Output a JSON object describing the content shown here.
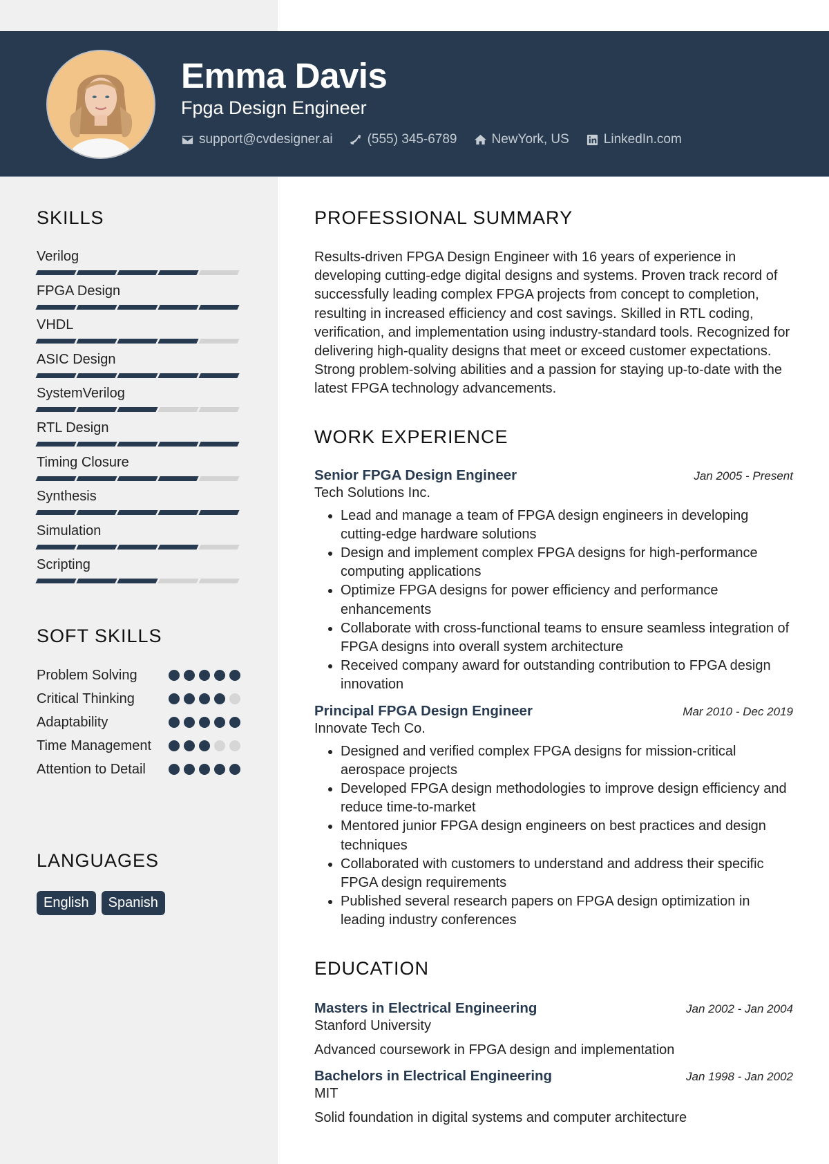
{
  "profile": {
    "name": "Emma Davis",
    "title": "Fpga Design Engineer",
    "contacts": [
      {
        "icon": "envelope-icon",
        "text": "support@cvdesigner.ai"
      },
      {
        "icon": "phone-icon",
        "text": "(555) 345-6789"
      },
      {
        "icon": "home-icon",
        "text": "NewYork, US"
      },
      {
        "icon": "linkedin-icon",
        "text": "LinkedIn.com"
      }
    ]
  },
  "colors": {
    "primary": "#273a4f",
    "sidebar": "#f0f0f0",
    "inactive": "#d3d3d3"
  },
  "skills": {
    "heading": "SKILLS",
    "max": 5,
    "items": [
      {
        "name": "Verilog",
        "level": 4
      },
      {
        "name": "FPGA Design",
        "level": 5
      },
      {
        "name": "VHDL",
        "level": 4
      },
      {
        "name": "ASIC Design",
        "level": 5
      },
      {
        "name": "SystemVerilog",
        "level": 3
      },
      {
        "name": "RTL Design",
        "level": 5
      },
      {
        "name": "Timing Closure",
        "level": 4
      },
      {
        "name": "Synthesis",
        "level": 5
      },
      {
        "name": "Simulation",
        "level": 4
      },
      {
        "name": "Scripting",
        "level": 3
      }
    ]
  },
  "soft_skills": {
    "heading": "SOFT SKILLS",
    "max": 5,
    "items": [
      {
        "name": "Problem Solving",
        "level": 5
      },
      {
        "name": "Critical Thinking",
        "level": 4
      },
      {
        "name": "Adaptability",
        "level": 5
      },
      {
        "name": "Time Management",
        "level": 3
      },
      {
        "name": "Attention to Detail",
        "level": 5
      }
    ]
  },
  "languages": {
    "heading": "LANGUAGES",
    "items": [
      "English",
      "Spanish"
    ]
  },
  "summary": {
    "heading": "PROFESSIONAL SUMMARY",
    "text": "Results-driven FPGA Design Engineer with 16 years of experience in developing cutting-edge digital designs and systems. Proven track record of successfully leading complex FPGA projects from concept to completion, resulting in increased efficiency and cost savings. Skilled in RTL coding, verification, and implementation using industry-standard tools. Recognized for delivering high-quality designs that meet or exceed customer expectations. Strong problem-solving abilities and a passion for staying up-to-date with the latest FPGA technology advancements."
  },
  "work": {
    "heading": "WORK EXPERIENCE",
    "jobs": [
      {
        "title": "Senior FPGA Design Engineer",
        "company": "Tech Solutions Inc.",
        "dates": "Jan 2005 - Present",
        "bullets": [
          "Lead and manage a team of FPGA design engineers in developing cutting-edge hardware solutions",
          "Design and implement complex FPGA designs for high-performance computing applications",
          "Optimize FPGA designs for power efficiency and performance enhancements",
          "Collaborate with cross-functional teams to ensure seamless integration of FPGA designs into overall system architecture",
          "Received company award for outstanding contribution to FPGA design innovation"
        ]
      },
      {
        "title": "Principal FPGA Design Engineer",
        "company": "Innovate Tech Co.",
        "dates": "Mar 2010 - Dec 2019",
        "bullets": [
          "Designed and verified complex FPGA designs for mission-critical aerospace projects",
          "Developed FPGA design methodologies to improve design efficiency and reduce time-to-market",
          "Mentored junior FPGA design engineers on best practices and design techniques",
          "Collaborated with customers to understand and address their specific FPGA design requirements",
          "Published several research papers on FPGA design optimization in leading industry conferences"
        ]
      }
    ]
  },
  "education": {
    "heading": "EDUCATION",
    "items": [
      {
        "degree": "Masters in Electrical Engineering",
        "school": "Stanford University",
        "dates": "Jan 2002 - Jan 2004",
        "description": "Advanced coursework in FPGA design and implementation"
      },
      {
        "degree": "Bachelors in Electrical Engineering",
        "school": "MIT",
        "dates": "Jan 1998 - Jan 2002",
        "description": "Solid foundation in digital systems and computer architecture"
      }
    ]
  }
}
